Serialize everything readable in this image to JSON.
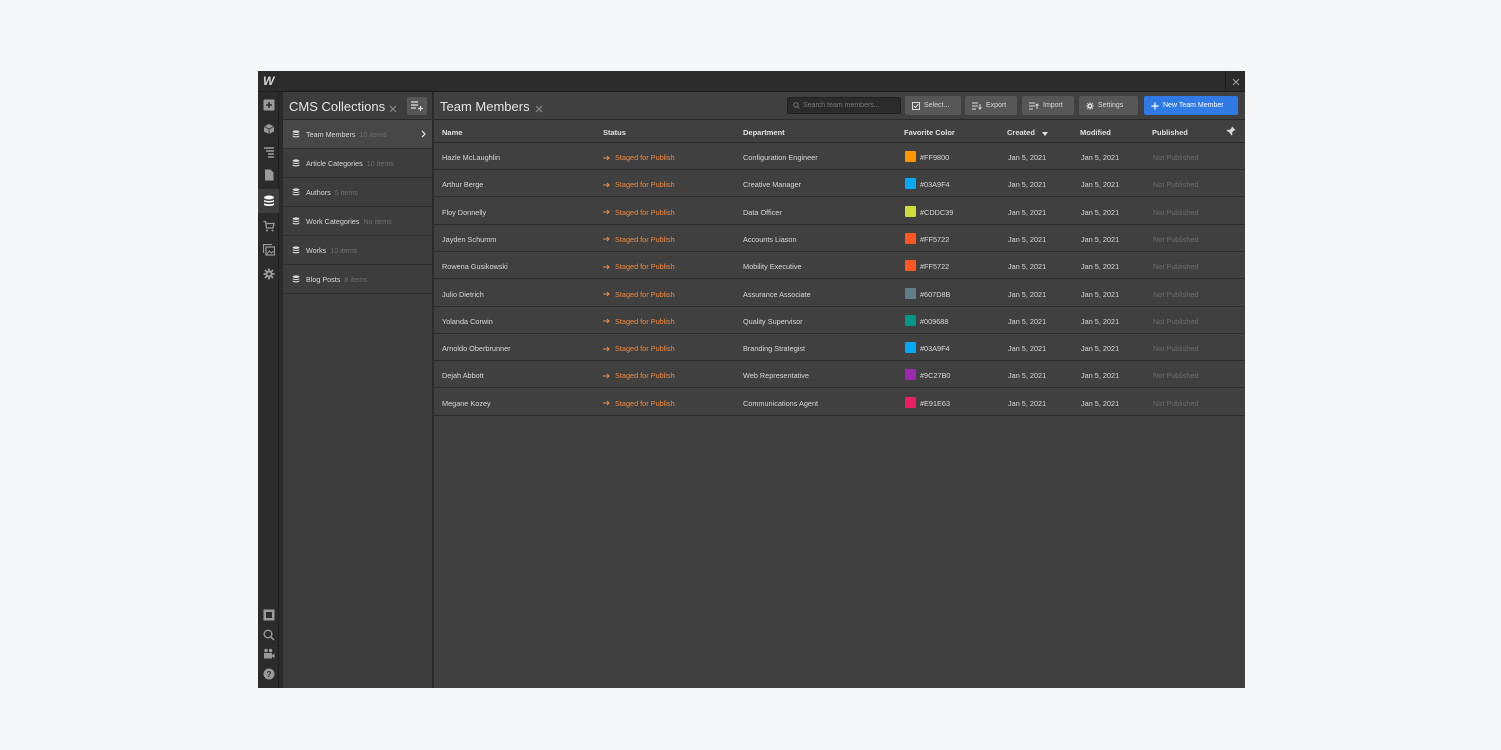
{
  "app": {
    "logo": "W"
  },
  "collections": {
    "title": "CMS Collections",
    "items": [
      {
        "name": "Team Members",
        "count": "10 items"
      },
      {
        "name": "Article Categories",
        "count": "10 items"
      },
      {
        "name": "Authors",
        "count": "5 items"
      },
      {
        "name": "Work Categories",
        "count": "No items"
      },
      {
        "name": "Works",
        "count": "10 items"
      },
      {
        "name": "Blog Posts",
        "count": "8 items"
      }
    ]
  },
  "main": {
    "title": "Team Members",
    "search_placeholder": "Search team members...",
    "buttons": {
      "select": "Select...",
      "export": "Export",
      "import": "Import",
      "settings": "Settings",
      "new_item": "New Team Member"
    },
    "columns": {
      "name": "Name",
      "status": "Status",
      "department": "Department",
      "color": "Favorite Color",
      "created": "Created",
      "modified": "Modified",
      "published": "Published"
    },
    "rows": [
      {
        "name": "Hazle McLaughlin",
        "status": "Staged for Publish",
        "department": "Configuration Engineer",
        "color": "#FF9800",
        "created": "Jan 5, 2021",
        "modified": "Jan 5, 2021",
        "published": "Not Published"
      },
      {
        "name": "Arthur Berge",
        "status": "Staged for Publish",
        "department": "Creative Manager",
        "color": "#03A9F4",
        "created": "Jan 5, 2021",
        "modified": "Jan 5, 2021",
        "published": "Not Published"
      },
      {
        "name": "Floy Donnelly",
        "status": "Staged for Publish",
        "department": "Data Officer",
        "color": "#CDDC39",
        "created": "Jan 5, 2021",
        "modified": "Jan 5, 2021",
        "published": "Not Published"
      },
      {
        "name": "Jayden Schumm",
        "status": "Staged for Publish",
        "department": "Accounts Liason",
        "color": "#FF5722",
        "created": "Jan 5, 2021",
        "modified": "Jan 5, 2021",
        "published": "Not Published"
      },
      {
        "name": "Rowena Gusikowski",
        "status": "Staged for Publish",
        "department": "Mobility Executive",
        "color": "#FF5722",
        "created": "Jan 5, 2021",
        "modified": "Jan 5, 2021",
        "published": "Not Published"
      },
      {
        "name": "Julio Dietrich",
        "status": "Staged for Publish",
        "department": "Assurance Associate",
        "color": "#607D8B",
        "created": "Jan 5, 2021",
        "modified": "Jan 5, 2021",
        "published": "Not Published"
      },
      {
        "name": "Yolanda Corwin",
        "status": "Staged for Publish",
        "department": "Quality Supervisor",
        "color": "#009688",
        "created": "Jan 5, 2021",
        "modified": "Jan 5, 2021",
        "published": "Not Published"
      },
      {
        "name": "Arnoldo Oberbrunner",
        "status": "Staged for Publish",
        "department": "Branding Strategist",
        "color": "#03A9F4",
        "created": "Jan 5, 2021",
        "modified": "Jan 5, 2021",
        "published": "Not Published"
      },
      {
        "name": "Dejah Abbott",
        "status": "Staged for Publish",
        "department": "Web Representative",
        "color": "#9C27B0",
        "created": "Jan 5, 2021",
        "modified": "Jan 5, 2021",
        "published": "Not Published"
      },
      {
        "name": "Megane Kozey",
        "status": "Staged for Publish",
        "department": "Communications Agent",
        "color": "#E91E63",
        "created": "Jan 5, 2021",
        "modified": "Jan 5, 2021",
        "published": "Not Published"
      }
    ]
  }
}
